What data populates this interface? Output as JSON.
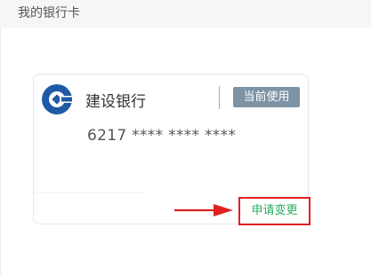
{
  "header": {
    "title": "我的银行卡"
  },
  "card": {
    "bank_name": "建设银行",
    "status_badge": "当前使用",
    "number": "6217 **** **** ****",
    "change_link": "申请变更",
    "logo_icon": "ccb-bank-logo-icon"
  },
  "colors": {
    "badge_bg": "#7d93a6",
    "link": "#27ae60",
    "highlight": "#e02020",
    "logo": "#1f5aa6"
  }
}
